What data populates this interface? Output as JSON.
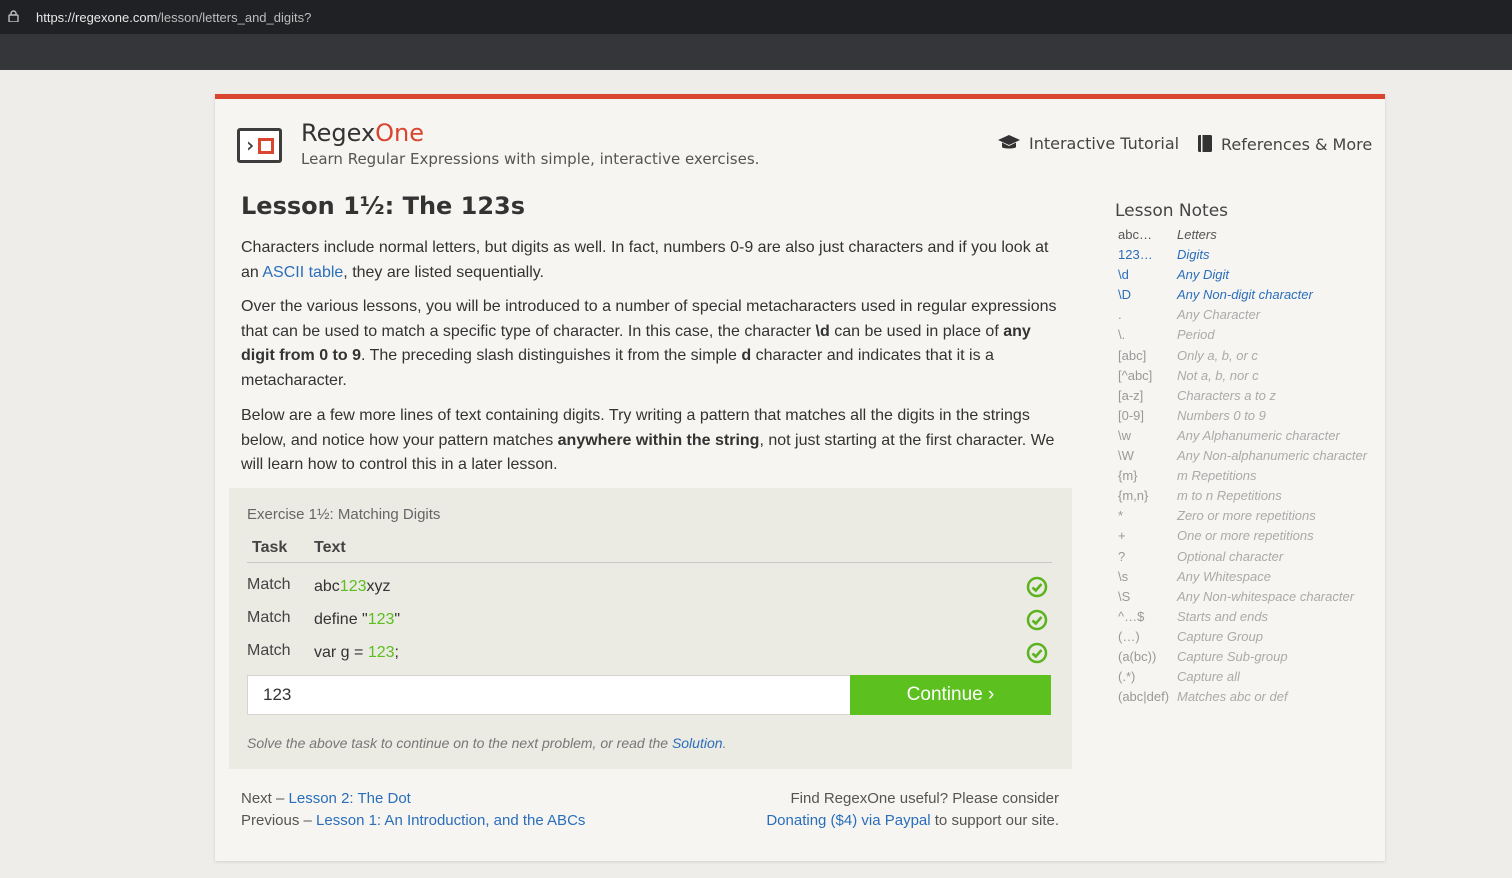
{
  "browser": {
    "url_domain": "https://regexone.com",
    "url_path": "/lesson/letters_and_digits?"
  },
  "header": {
    "brand_main": "Regex",
    "brand_accent": "One",
    "tagline": "Learn Regular Expressions with simple, interactive exercises.",
    "nav_tutorial": "Interactive Tutorial",
    "nav_references": "References & More"
  },
  "lesson": {
    "title": "Lesson 1½: The 123s",
    "p1_a": "Characters include normal letters, but digits as well. In fact, numbers 0-9 are also just characters and if you look at an ",
    "p1_link": "ASCII table",
    "p1_b": ", they are listed sequentially.",
    "p2_a": "Over the various lessons, you will be introduced to a number of special metacharacters used in regular expressions that can be used to match a specific type of character. In this case, the character ",
    "p2_code": "\\d",
    "p2_b": " can be used in place of ",
    "p2_strong": "any digit from 0 to 9",
    "p2_c": ". The preceding slash distinguishes it from the simple ",
    "p2_d_char": "d",
    "p2_e": " character and indicates that it is a metacharacter.",
    "p3_a": "Below are a few more lines of text containing digits. Try writing a pattern that matches all the digits in the strings below, and notice how your pattern matches ",
    "p3_strong": "anywhere within the string",
    "p3_b": ", not just starting at the first character. We will learn how to control this in a later lesson."
  },
  "exercise": {
    "title": "Exercise 1½: Matching Digits",
    "col_task": "Task",
    "col_text": "Text",
    "rows": [
      {
        "task": "Match",
        "pre": "abc",
        "hl": "123",
        "post": "xyz"
      },
      {
        "task": "Match",
        "pre": "define \"",
        "hl": "123",
        "post": "\""
      },
      {
        "task": "Match",
        "pre": "var g = ",
        "hl": "123",
        "post": ";"
      }
    ],
    "input_value": "123",
    "continue_label": "Continue ›",
    "hint_a": "Solve the above task to continue on to the next problem, or read the ",
    "hint_link": "Solution",
    "hint_b": "."
  },
  "footer": {
    "next_label": "Next – ",
    "next_link": "Lesson 2: The Dot",
    "prev_label": "Previous – ",
    "prev_link": "Lesson 1: An Introduction, and the ABCs",
    "support_a": "Find RegexOne useful? Please consider",
    "support_link": "Donating ($4) via Paypal",
    "support_b": " to support our site."
  },
  "notes": {
    "title": "Lesson Notes",
    "items": [
      {
        "key": "abc…",
        "desc": "Letters",
        "state": "done"
      },
      {
        "key": "123…",
        "desc": "Digits",
        "state": "cur"
      },
      {
        "key": "\\d",
        "desc": "Any Digit",
        "state": "cur"
      },
      {
        "key": "\\D",
        "desc": "Any Non-digit character",
        "state": "cur"
      },
      {
        "key": ".",
        "desc": "Any Character",
        "state": "todo"
      },
      {
        "key": "\\.",
        "desc": "Period",
        "state": "todo"
      },
      {
        "key": "[abc]",
        "desc": "Only a, b, or c",
        "state": "todo"
      },
      {
        "key": "[^abc]",
        "desc": "Not a, b, nor c",
        "state": "todo"
      },
      {
        "key": "[a-z]",
        "desc": "Characters a to z",
        "state": "todo"
      },
      {
        "key": "[0-9]",
        "desc": "Numbers 0 to 9",
        "state": "todo"
      },
      {
        "key": "\\w",
        "desc": "Any Alphanumeric character",
        "state": "todo"
      },
      {
        "key": "\\W",
        "desc": "Any Non-alphanumeric character",
        "state": "todo"
      },
      {
        "key": "{m}",
        "desc": "m Repetitions",
        "state": "todo"
      },
      {
        "key": "{m,n}",
        "desc": "m to n Repetitions",
        "state": "todo"
      },
      {
        "key": "*",
        "desc": "Zero or more repetitions",
        "state": "todo"
      },
      {
        "key": "+",
        "desc": "One or more repetitions",
        "state": "todo"
      },
      {
        "key": "?",
        "desc": "Optional character",
        "state": "todo"
      },
      {
        "key": "\\s",
        "desc": "Any Whitespace",
        "state": "todo"
      },
      {
        "key": "\\S",
        "desc": "Any Non-whitespace character",
        "state": "todo"
      },
      {
        "key": "^…$",
        "desc": "Starts and ends",
        "state": "todo"
      },
      {
        "key": "(…)",
        "desc": "Capture Group",
        "state": "todo"
      },
      {
        "key": "(a(bc))",
        "desc": "Capture Sub-group",
        "state": "todo"
      },
      {
        "key": "(.*)",
        "desc": "Capture all",
        "state": "todo"
      },
      {
        "key": "(abc|def)",
        "desc": "Matches abc or def",
        "state": "todo"
      }
    ]
  }
}
